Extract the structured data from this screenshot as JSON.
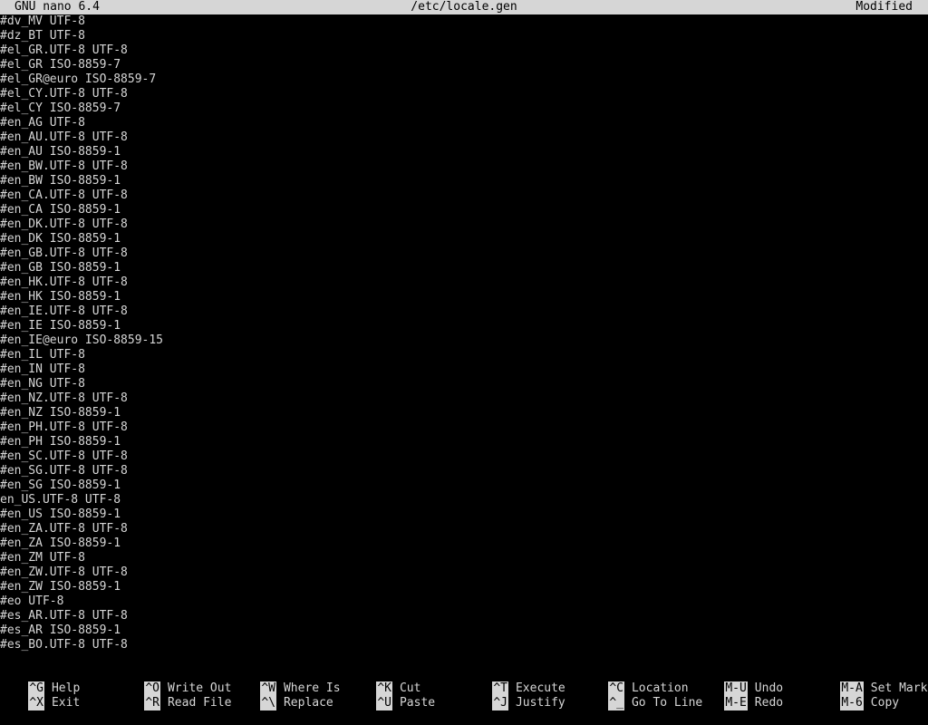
{
  "titlebar": {
    "app": "GNU nano 6.4",
    "file": "/etc/locale.gen",
    "status": "Modified"
  },
  "lines": [
    "#dv_MV UTF-8",
    "#dz_BT UTF-8",
    "#el_GR.UTF-8 UTF-8",
    "#el_GR ISO-8859-7",
    "#el_GR@euro ISO-8859-7",
    "#el_CY.UTF-8 UTF-8",
    "#el_CY ISO-8859-7",
    "#en_AG UTF-8",
    "#en_AU.UTF-8 UTF-8",
    "#en_AU ISO-8859-1",
    "#en_BW.UTF-8 UTF-8",
    "#en_BW ISO-8859-1",
    "#en_CA.UTF-8 UTF-8",
    "#en_CA ISO-8859-1",
    "#en_DK.UTF-8 UTF-8",
    "#en_DK ISO-8859-1",
    "#en_GB.UTF-8 UTF-8",
    "#en_GB ISO-8859-1",
    "#en_HK.UTF-8 UTF-8",
    "#en_HK ISO-8859-1",
    "#en_IE.UTF-8 UTF-8",
    "#en_IE ISO-8859-1",
    "#en_IE@euro ISO-8859-15",
    "#en_IL UTF-8",
    "#en_IN UTF-8",
    "#en_NG UTF-8",
    "#en_NZ.UTF-8 UTF-8",
    "#en_NZ ISO-8859-1",
    "#en_PH.UTF-8 UTF-8",
    "#en_PH ISO-8859-1",
    "#en_SC.UTF-8 UTF-8",
    "#en_SG.UTF-8 UTF-8",
    "#en_SG ISO-8859-1",
    "en_US.UTF-8 UTF-8",
    "#en_US ISO-8859-1",
    "#en_ZA.UTF-8 UTF-8",
    "#en_ZA ISO-8859-1",
    "#en_ZM UTF-8",
    "#en_ZW.UTF-8 UTF-8",
    "#en_ZW ISO-8859-1",
    "#eo UTF-8",
    "#es_AR.UTF-8 UTF-8",
    "#es_AR ISO-8859-1",
    "#es_BO.UTF-8 UTF-8"
  ],
  "shortcuts": {
    "help": {
      "key": "^G",
      "label": "Help"
    },
    "exit": {
      "key": "^X",
      "label": "Exit"
    },
    "write_out": {
      "key": "^O",
      "label": "Write Out"
    },
    "read_file": {
      "key": "^R",
      "label": "Read File"
    },
    "where_is": {
      "key": "^W",
      "label": "Where Is"
    },
    "replace": {
      "key": "^\\",
      "label": "Replace"
    },
    "cut": {
      "key": "^K",
      "label": "Cut"
    },
    "paste": {
      "key": "^U",
      "label": "Paste"
    },
    "execute": {
      "key": "^T",
      "label": "Execute"
    },
    "justify": {
      "key": "^J",
      "label": "Justify"
    },
    "location": {
      "key": "^C",
      "label": "Location"
    },
    "go_to_line": {
      "key": "^_",
      "label": "Go To Line"
    },
    "undo": {
      "key": "M-U",
      "label": "Undo"
    },
    "redo": {
      "key": "M-E",
      "label": "Redo"
    },
    "set_mark": {
      "key": "M-A",
      "label": "Set Mark"
    },
    "copy": {
      "key": "M-6",
      "label": "Copy"
    }
  },
  "colors": {
    "background": "#000000",
    "foreground": "#d6d6d6",
    "inverse_bg": "#d6d6d6",
    "inverse_fg": "#000000"
  }
}
